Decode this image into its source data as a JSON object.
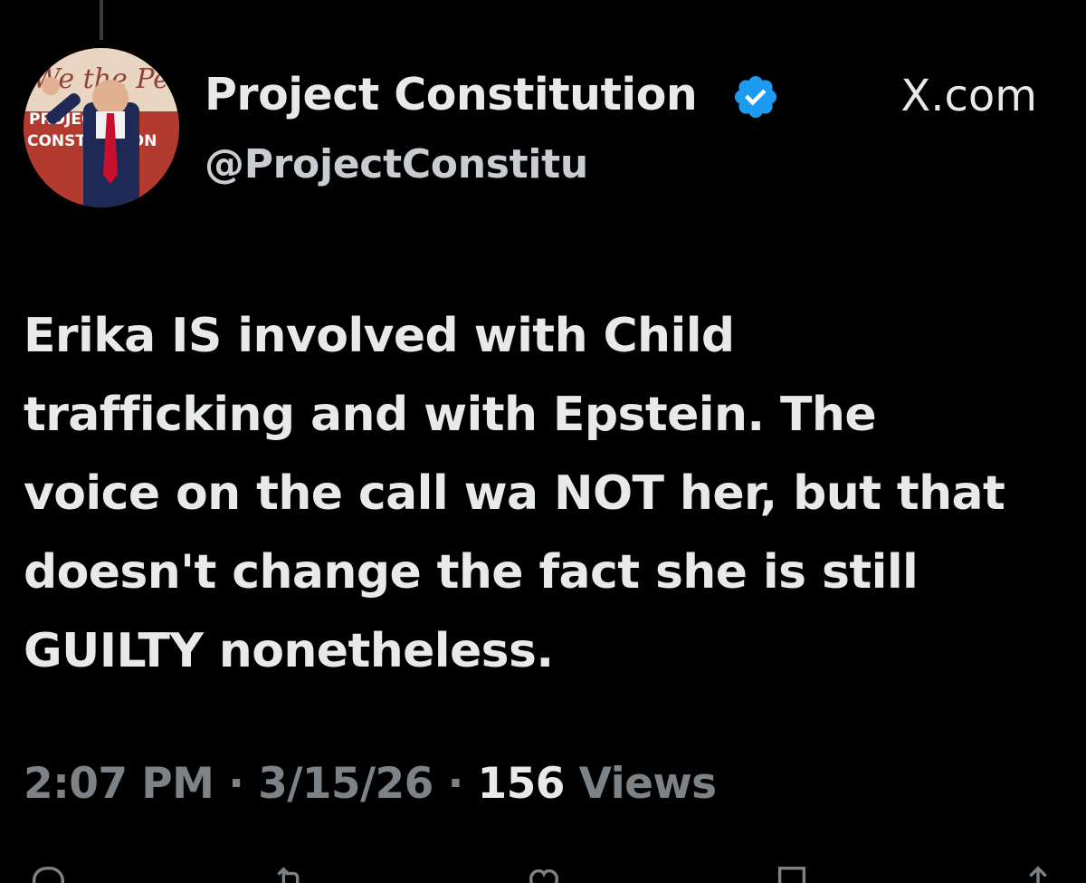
{
  "tweet": {
    "display_name": "Project Constitution",
    "handle": "@ProjectConstitu",
    "verified": true,
    "source_watermark": "X.com",
    "text_lines": [
      "Erika IS involved with Child",
      "trafficking and with Epstein. The",
      "voice on the call wa NOT her, but that",
      "doesn't change the fact she is still",
      "GUILTY nonetheless."
    ],
    "time": "2:07 PM",
    "separator": "·",
    "date": "3/15/26",
    "views_count": "156",
    "views_label": "Views"
  },
  "avatar": {
    "text_top": "We the People",
    "text_line1": "PROJECT",
    "text_line2": "CONSTITUTION"
  },
  "colors": {
    "background": "#000000",
    "text_primary": "#e7e9ea",
    "text_secondary": "#7d8287",
    "verified_badge": "#1d9bf0"
  },
  "icons": {
    "verified": "verified-badge-icon",
    "reply": "reply-icon",
    "repost": "repost-icon",
    "like": "heart-icon",
    "share": "share-icon"
  }
}
